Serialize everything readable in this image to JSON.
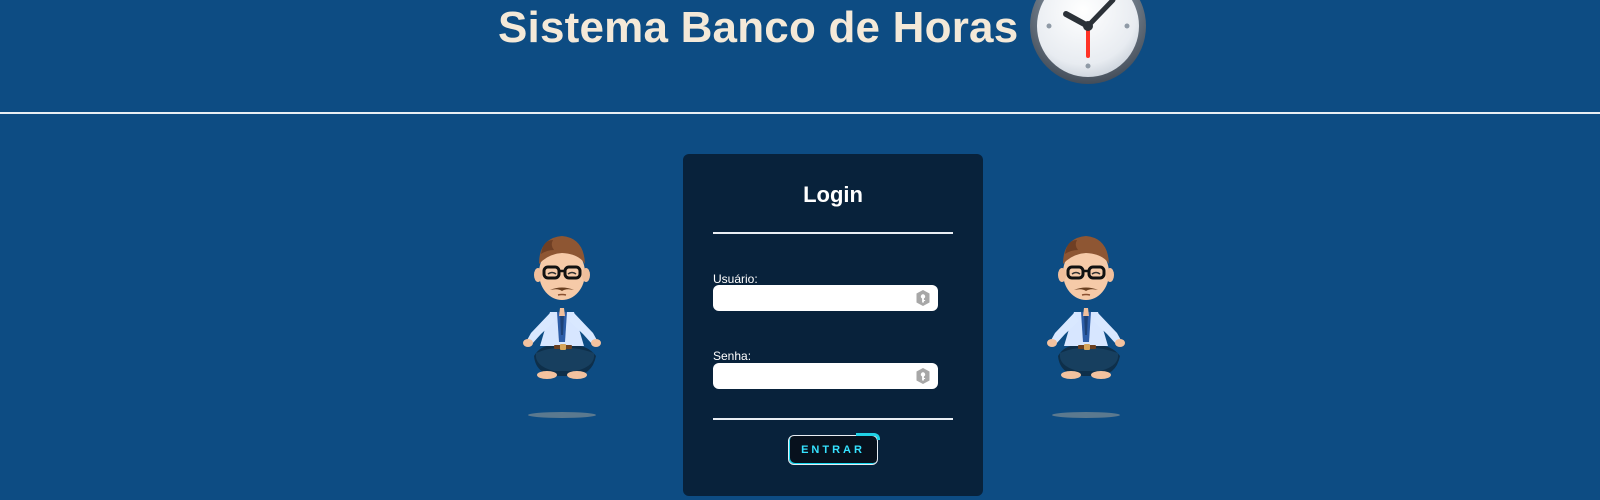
{
  "header": {
    "title": "Sistema Banco de Horas",
    "clock_icon": "clock-icon"
  },
  "login": {
    "title": "Login",
    "user_label": "Usuário:",
    "password_label": "Senha:",
    "user_value": "",
    "password_value": "",
    "button_label": "ENTRAR"
  },
  "decorations": {
    "left_figure": "meditating-man-icon",
    "right_figure": "meditating-man-icon"
  },
  "colors": {
    "background": "#0d4c83",
    "card": "#08223b",
    "title_text": "#f4e9d8",
    "button_text": "#35e2ff"
  }
}
